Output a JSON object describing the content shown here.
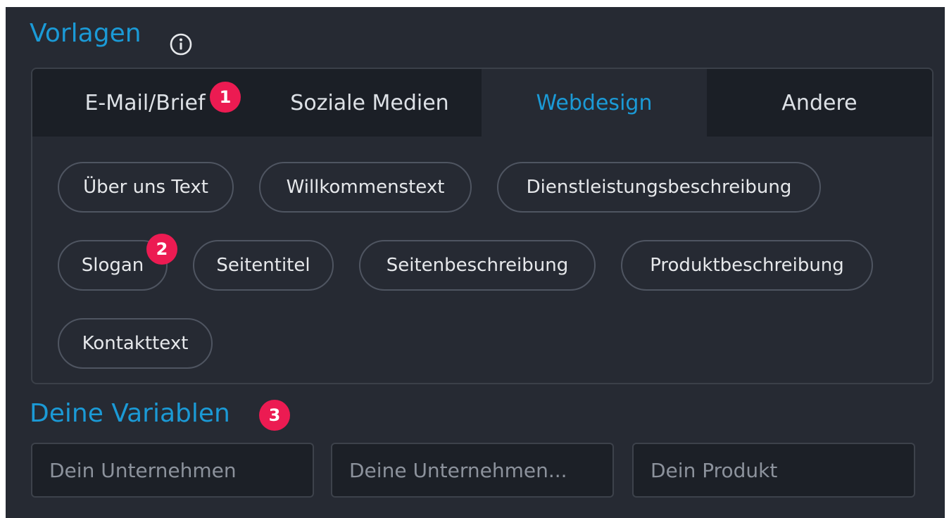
{
  "templates": {
    "title": "Vorlagen",
    "tabs": [
      {
        "label": "E-Mail/Brief"
      },
      {
        "label": "Soziale Medien"
      },
      {
        "label": "Webdesign",
        "active": true
      },
      {
        "label": "Andere"
      }
    ],
    "chips": [
      "Über uns Text",
      "Willkommenstext",
      "Dienstleistungsbeschreibung",
      "Slogan",
      "Seitentitel",
      "Seitenbeschreibung",
      "Produktbeschreibung",
      "Kontakttext"
    ]
  },
  "variables": {
    "title": "Deine Variablen",
    "fields": [
      {
        "placeholder": "Dein Unternehmen"
      },
      {
        "placeholder": "Deine Unternehmen..."
      },
      {
        "placeholder": "Dein Produkt"
      }
    ]
  },
  "badges": [
    "1",
    "2",
    "3"
  ],
  "colors": {
    "background": "#262a33",
    "accent": "#1b9ad6",
    "badge": "#ec1b52",
    "tab_inactive_bg": "#1b1f26"
  },
  "icons": {
    "info": "info-circle-icon"
  }
}
